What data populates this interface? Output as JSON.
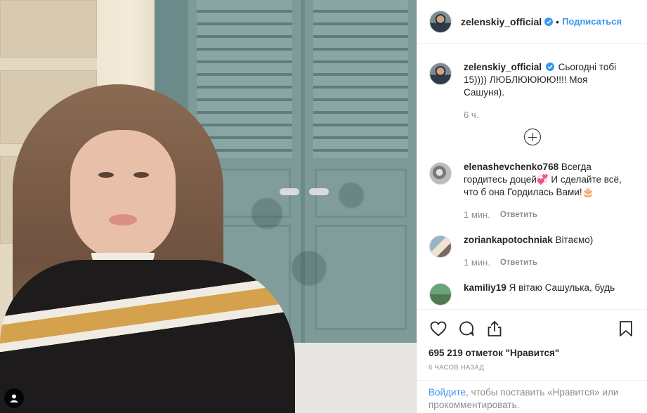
{
  "header": {
    "username": "zelenskiy_official",
    "separator": "•",
    "follow_label": "Подписаться"
  },
  "caption": {
    "username": "zelenskiy_official",
    "text": "Сьогодні тобі 15)))) ЛЮБЛЮЮЮЮ!!!! Моя Сашуня).",
    "time": "6 ч."
  },
  "comments": [
    {
      "username": "elenashevchenko768",
      "text": "Всегда гордитесь доцей💞 И сделайте всё, что б она Гордилась Вами!🎂",
      "time": "1 мин.",
      "reply_label": "Ответить"
    },
    {
      "username": "zoriankapotochniak",
      "text": "Вітаємо)",
      "time": "1 мин.",
      "reply_label": "Ответить"
    },
    {
      "username": "kamiliy19",
      "text": "Я вітаю Сашулька, будь"
    }
  ],
  "stats": {
    "likes_text": "695 219 отметок \"Нравится\"",
    "posted_ago": "6 ЧАСОВ НАЗАД"
  },
  "login_prompt": {
    "link": "Войдите",
    "rest": ", чтобы поставить «Нравится» или прокомментировать."
  },
  "icons": {
    "like": "heart-icon",
    "comment": "comment-icon",
    "share": "share-icon",
    "save": "bookmark-icon",
    "photo_badge": "user-tag-icon",
    "add": "plus-circle-icon",
    "verified": "verified-badge-icon"
  },
  "colors": {
    "link_blue": "#3897f0",
    "text": "#262626",
    "muted": "#8e8e8e",
    "border": "#efefef"
  }
}
